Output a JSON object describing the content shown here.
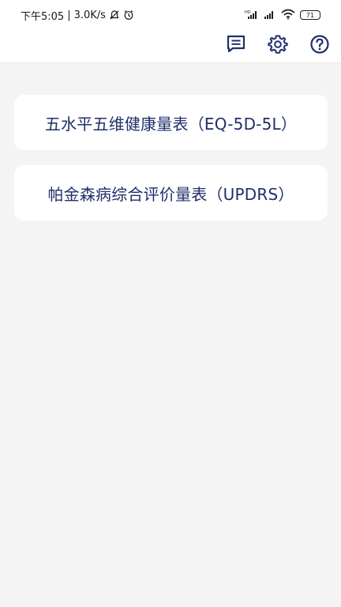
{
  "status_bar": {
    "time": "下午5:05",
    "speed": "3.0K/s",
    "battery": "71",
    "icons": [
      "mute-bell-icon",
      "alarm-icon",
      "hd-signal-icon",
      "signal-icon",
      "wifi-icon",
      "battery-icon"
    ]
  },
  "toolbar": {
    "icons": [
      "message-icon",
      "settings-gear-icon",
      "help-question-icon"
    ],
    "accent_color": "#1f2f6b"
  },
  "scales": [
    {
      "label": "五水平五维健康量表（EQ-5D-5L）"
    },
    {
      "label": "帕金森病综合评价量表（UPDRS）"
    }
  ]
}
